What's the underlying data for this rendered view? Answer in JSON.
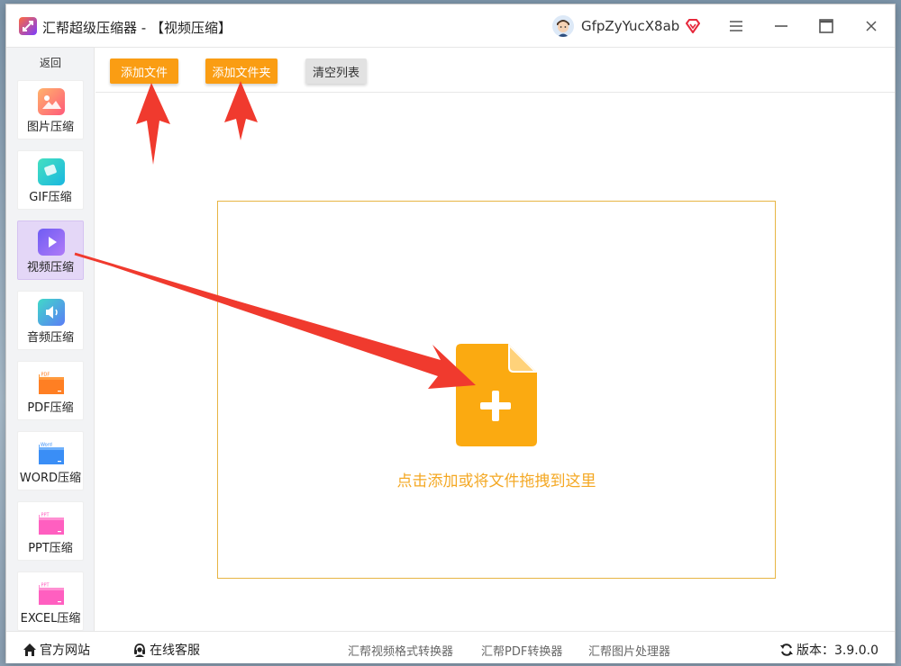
{
  "window": {
    "title": "汇帮超级压缩器",
    "subtitle": " - 【视频压缩】",
    "username": "GfpZyYucX8ab"
  },
  "sidebar": {
    "back_label": "返回",
    "items": [
      {
        "label": "图片压缩",
        "icon": "image-icon",
        "color": "#ff7a6b"
      },
      {
        "label": "GIF压缩",
        "icon": "gif-icon",
        "color": "#2ad2c9"
      },
      {
        "label": "视频压缩",
        "icon": "video-play-icon",
        "color": "#8b6cf6",
        "active": true
      },
      {
        "label": "音频压缩",
        "icon": "audio-icon",
        "color": "#39c7d9"
      },
      {
        "label": "PDF压缩",
        "icon": "pdf-folder-icon",
        "color": "#ff8a2a",
        "badge": "PDF"
      },
      {
        "label": "WORD压缩",
        "icon": "word-folder-icon",
        "color": "#3a8ef6",
        "badge": "Word"
      },
      {
        "label": "PPT压缩",
        "icon": "ppt-folder-icon",
        "color": "#ff5fc0",
        "badge": "PPT"
      },
      {
        "label": "EXCEL压缩",
        "icon": "excel-folder-icon",
        "color": "#ff5fc0",
        "badge": "PPT"
      }
    ]
  },
  "toolbar": {
    "add_file": "添加文件",
    "add_folder": "添加文件夹",
    "clear_list": "清空列表"
  },
  "dropzone": {
    "text": "点击添加或将文件拖拽到这里",
    "accent": "#fbaa11"
  },
  "bottombar": {
    "website": "官方网站",
    "support": "在线客服",
    "links": [
      "汇帮视频格式转换器",
      "汇帮PDF转换器",
      "汇帮图片处理器"
    ],
    "version_label": "版本：",
    "version": "3.9.0.0"
  },
  "colors": {
    "accent_orange": "#fa9d13",
    "annotation_red": "#f03a2e",
    "active_nav": "#e4d7f7"
  }
}
